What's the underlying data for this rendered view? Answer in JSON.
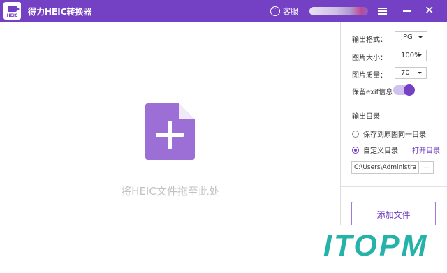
{
  "app": {
    "title": "得力HEIC转换器",
    "logo_text": "HEIC"
  },
  "titlebar": {
    "service_label": "客服"
  },
  "dropzone": {
    "text": "将HEIC文件拖至此处"
  },
  "settings": {
    "format_label": "输出格式：",
    "format_value": "JPG",
    "size_label": "图片大小：",
    "size_value": "100%",
    "quality_label": "图片质量：",
    "quality_value": "70",
    "exif_label": "保留exif信息",
    "exif_enabled": true
  },
  "output": {
    "title": "输出目录",
    "option_same": "保存到原图同一目录",
    "option_custom": "自定义目录",
    "selected_option": "custom",
    "open_link": "打开目录",
    "path_value": "C:\\Users\\Administra",
    "browse_label": "..."
  },
  "actions": {
    "add_files": "添加文件"
  },
  "watermark": {
    "text": "ITOPM"
  },
  "colors": {
    "accent": "#7440c4",
    "watermark": "#25b3a9"
  },
  "icons": [
    "app-logo-icon",
    "chat-service-icon",
    "menu-icon",
    "minimize-icon",
    "close-icon",
    "add-file-icon",
    "dropdown-caret-icon"
  ]
}
